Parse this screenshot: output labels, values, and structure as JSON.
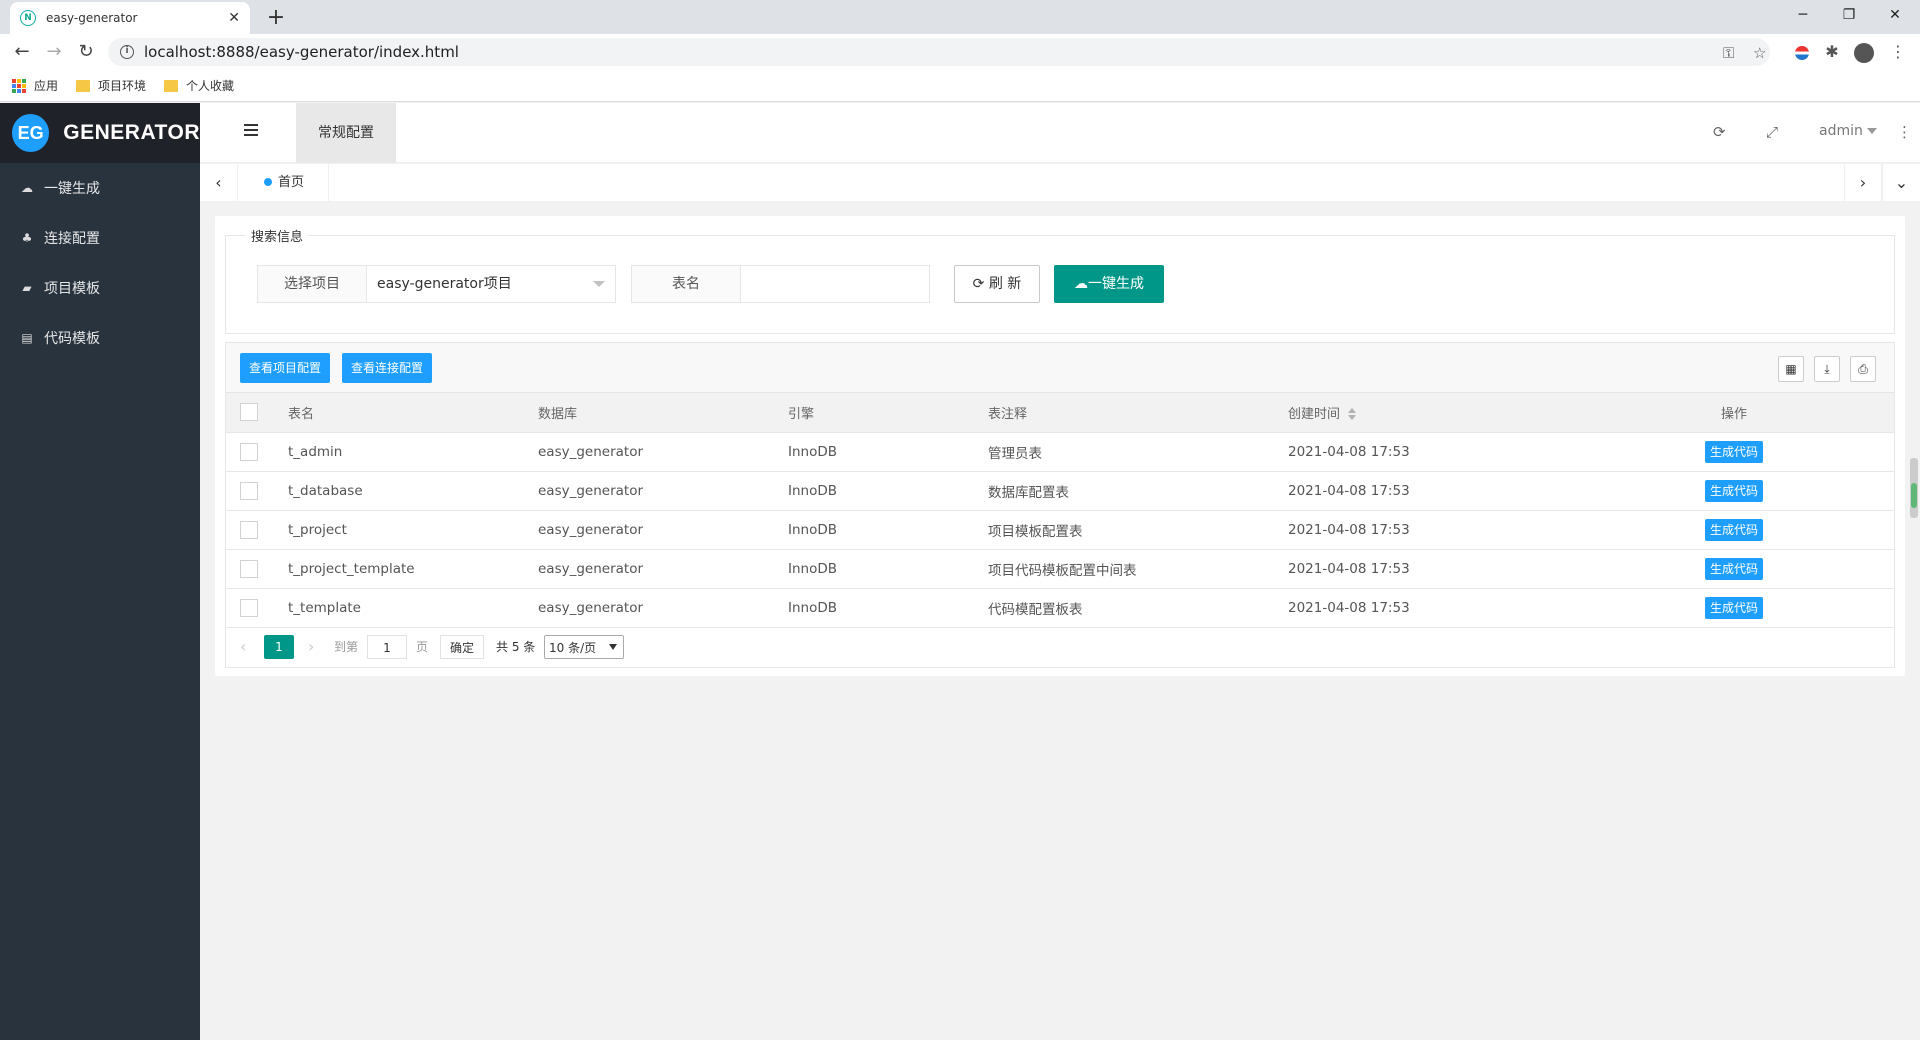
{
  "browser": {
    "tab_title": "easy-generator",
    "url": "localhost:8888/easy-generator/index.html",
    "bookmarks": [
      "应用",
      "项目环境",
      "个人收藏"
    ]
  },
  "sidebar": {
    "logo_badge": "EG",
    "logo_text": "GENERATOR",
    "items": [
      {
        "label": "一键生成",
        "icon": "cloud-download-icon"
      },
      {
        "label": "连接配置",
        "icon": "sitemap-icon"
      },
      {
        "label": "项目模板",
        "icon": "folder-open-icon"
      },
      {
        "label": "代码模板",
        "icon": "code-file-icon"
      }
    ]
  },
  "header": {
    "nav_tab": "常规配置",
    "user": "admin"
  },
  "tabs": {
    "home": "首页"
  },
  "search": {
    "legend": "搜索信息",
    "project_label": "选择项目",
    "project_value": "easy-generator项目",
    "table_label": "表名",
    "table_value": "",
    "refresh_label": "刷 新",
    "generate_label": "一键生成"
  },
  "table": {
    "toolbar_buttons": [
      "查看项目配置",
      "查看连接配置"
    ],
    "columns": [
      "表名",
      "数据库",
      "引擎",
      "表注释",
      "创建时间",
      "操作"
    ],
    "rows": [
      {
        "name": "t_admin",
        "db": "easy_generator",
        "engine": "InnoDB",
        "comment": "管理员表",
        "created": "2021-04-08 17:53",
        "action": "生成代码"
      },
      {
        "name": "t_database",
        "db": "easy_generator",
        "engine": "InnoDB",
        "comment": "数据库配置表",
        "created": "2021-04-08 17:53",
        "action": "生成代码"
      },
      {
        "name": "t_project",
        "db": "easy_generator",
        "engine": "InnoDB",
        "comment": "项目模板配置表",
        "created": "2021-04-08 17:53",
        "action": "生成代码"
      },
      {
        "name": "t_project_template",
        "db": "easy_generator",
        "engine": "InnoDB",
        "comment": "项目代码模板配置中间表",
        "created": "2021-04-08 17:53",
        "action": "生成代码"
      },
      {
        "name": "t_template",
        "db": "easy_generator",
        "engine": "InnoDB",
        "comment": "代码模配置板表",
        "created": "2021-04-08 17:53",
        "action": "生成代码"
      }
    ]
  },
  "pager": {
    "current_page": "1",
    "goto_label": "到第",
    "goto_value": "1",
    "page_unit": "页",
    "confirm": "确定",
    "total": "共 5 条",
    "page_size": "10 条/页"
  },
  "colors": {
    "sidebar": "#28333e",
    "primary_green": "#009688",
    "primary_blue": "#1e9fff"
  }
}
